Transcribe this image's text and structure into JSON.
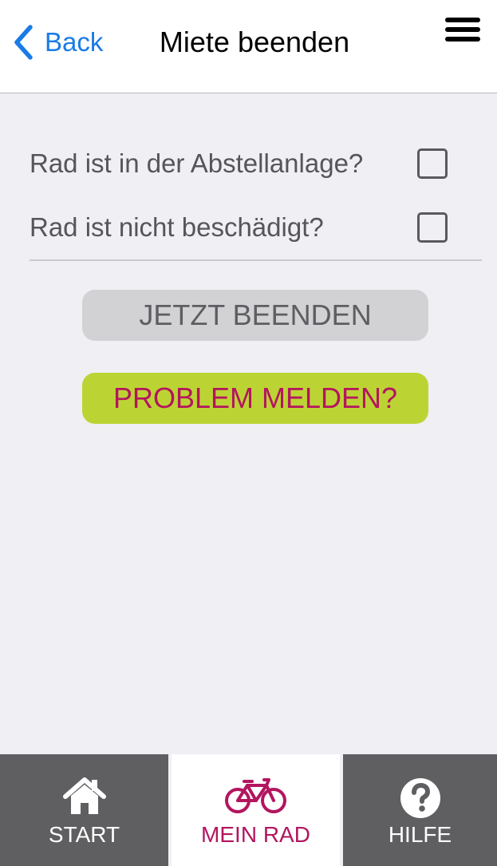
{
  "navbar": {
    "back_label": "Back",
    "title": "Miete beenden",
    "back_icon": "chevron-left-icon",
    "menu_icon": "hamburger-menu-icon"
  },
  "checklist": [
    {
      "label": "Rad ist in der Abstellanlage?",
      "checked": false
    },
    {
      "label": "Rad ist nicht beschädigt?",
      "checked": false
    }
  ],
  "actions": {
    "end_label": "JETZT BEENDEN",
    "problem_label": "PROBLEM MELDEN?"
  },
  "tabbar": {
    "active": "mein-rad",
    "tabs": [
      {
        "label": "START",
        "icon": "home-icon"
      },
      {
        "label": "MEIN RAD",
        "icon": "bicycle-icon"
      },
      {
        "label": "HILFE",
        "icon": "question-circle-icon"
      }
    ]
  },
  "colors": {
    "accent_blue": "#1a7be6",
    "brand_magenta": "#b3155f",
    "brand_green": "#bcd433",
    "disabled_gray": "#d2d2d4",
    "tab_gray": "#5f5f61",
    "background": "#efeff4"
  }
}
